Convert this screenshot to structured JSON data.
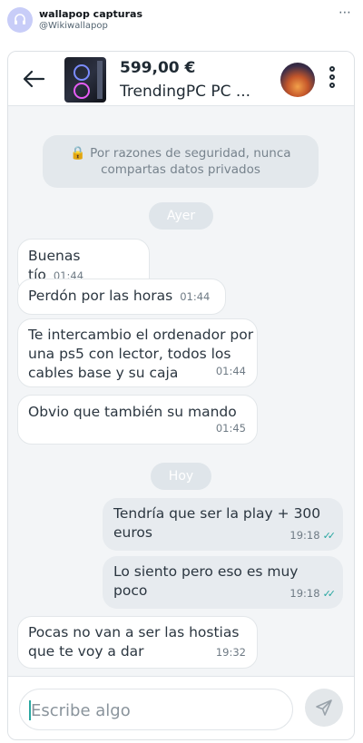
{
  "tweet": {
    "account_name": "wallapop capturas",
    "handle": "@Wikiwallapop",
    "more_icon": "⋯"
  },
  "header": {
    "price": "599,00 €",
    "product_title": "TrendingPC PC ..."
  },
  "chat": {
    "security_notice_icon": "🔒",
    "security_notice": "Por razones de seguridad, nunca compartas datos privados",
    "day_labels": [
      "Ayer",
      "Hoy"
    ],
    "messages": [
      {
        "direction": "in",
        "text": "Buenas tío",
        "time": "01:44"
      },
      {
        "direction": "in",
        "text": "Perdón por las horas",
        "time": "01:44"
      },
      {
        "direction": "in",
        "text": "Te intercambio el ordenador por una ps5 con lector, todos los cables base y su caja",
        "time": "01:44"
      },
      {
        "direction": "in",
        "text": "Obvio que también su mando",
        "time": "01:45"
      },
      {
        "direction": "out",
        "text": "Tendría que ser la play + 300 euros",
        "time": "19:18",
        "status": "read"
      },
      {
        "direction": "out",
        "text": "Lo siento pero eso es muy poco",
        "time": "19:18",
        "status": "read"
      },
      {
        "direction": "in",
        "text": "Pocas no van a ser las hostias que te voy a dar",
        "time": "19:32"
      }
    ]
  },
  "composer": {
    "placeholder": "Escribe algo"
  },
  "colors": {
    "read_ticks": "#26a6a0",
    "notice_bg": "#e3e8ec",
    "outgoing_bg": "#e7ebef"
  },
  "icons": {
    "back": "arrow-left-icon",
    "menu": "kebab-menu-icon",
    "lock": "lock-icon",
    "send": "paper-plane-icon",
    "read": "double-check-icon"
  }
}
